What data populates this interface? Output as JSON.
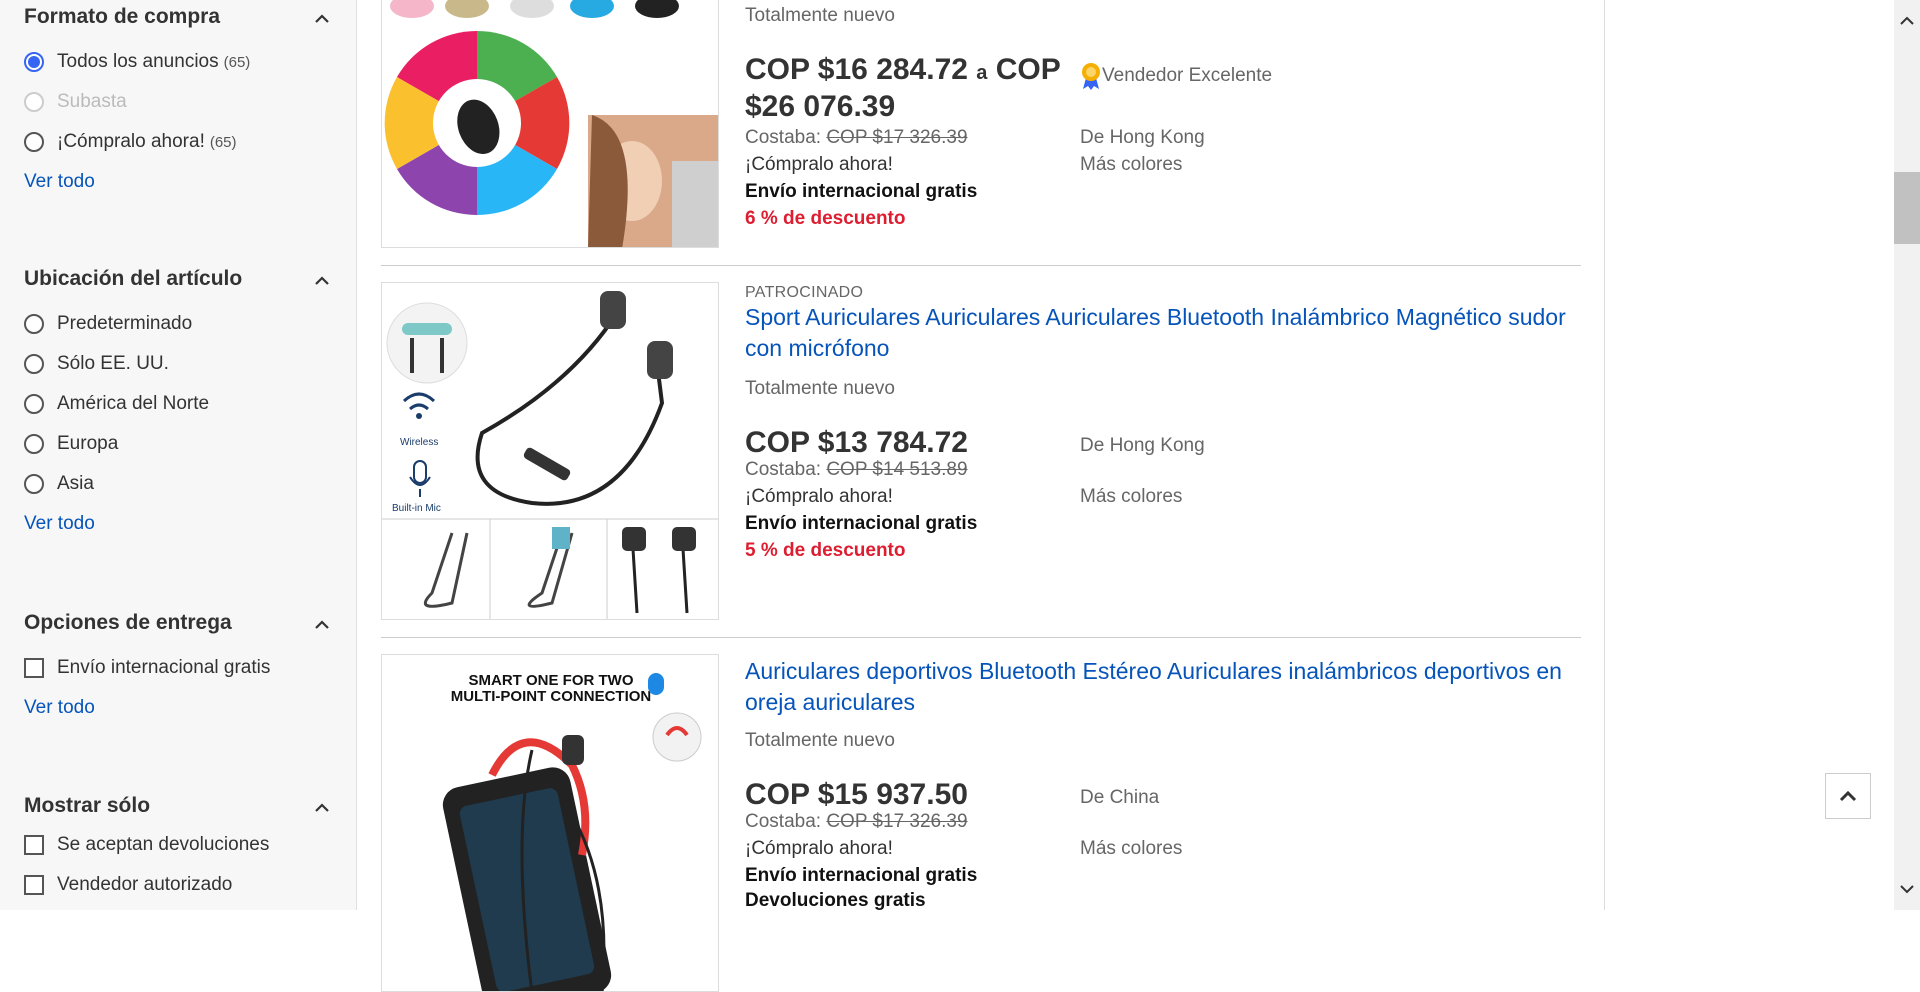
{
  "sidebar": {
    "formato": {
      "title": "Formato de compra",
      "options": [
        {
          "label": "Todos los anuncios",
          "count": "(65)"
        },
        {
          "label": "Subasta"
        },
        {
          "label": "¡Cómpralo ahora!",
          "count": "(65)"
        }
      ],
      "see_all": "Ver todo"
    },
    "ubicacion": {
      "title": "Ubicación del artículo",
      "options": [
        "Predeterminado",
        "Sólo EE. UU.",
        "América del Norte",
        "Europa",
        "Asia"
      ],
      "see_all": "Ver todo"
    },
    "entrega": {
      "title": "Opciones de entrega",
      "options": [
        "Envío internacional gratis"
      ],
      "see_all": "Ver todo"
    },
    "mostrar": {
      "title": "Mostrar sólo",
      "options": [
        "Se aceptan devoluciones",
        "Vendedor autorizado"
      ]
    }
  },
  "items": [
    {
      "condition": "Totalmente nuevo",
      "price": "COP $16 284.72",
      "price_sep": "a",
      "price_to": "COP $26 076.39",
      "was_label": "Costaba:",
      "was_price": "COP $17 326.39",
      "buy": "¡Cómpralo ahora!",
      "ship": "Envío internacional gratis",
      "discount": "6 % de descuento",
      "seller_badge": "Vendedor Excelente",
      "from": "De Hong Kong",
      "colors": "Más colores"
    },
    {
      "sponsored": "PATROCINADO",
      "title": "Sport Auriculares Auriculares Auriculares Bluetooth Inalámbrico Magnético sudor con micrófono",
      "condition": "Totalmente nuevo",
      "price": "COP $13 784.72",
      "was_label": "Costaba:",
      "was_price": "COP $14 513.89",
      "buy": "¡Cómpralo ahora!",
      "ship": "Envío internacional gratis",
      "discount": "5 % de descuento",
      "from": "De Hong Kong",
      "colors": "Más colores",
      "img_labels": {
        "wireless": "Wireless",
        "mic": "Built-in Mic"
      }
    },
    {
      "title": "Auriculares deportivos Bluetooth Estéreo Auriculares inalámbricos deportivos en oreja auriculares",
      "condition": "Totalmente nuevo",
      "price": "COP $15 937.50",
      "was_label": "Costaba:",
      "was_price": "COP $17 326.39",
      "buy": "¡Cómpralo ahora!",
      "ship": "Envío internacional gratis",
      "returns": "Devoluciones gratis",
      "from": "De China",
      "colors": "Más colores",
      "img_labels": {
        "line1": "SMART ONE FOR TWO",
        "line2": "MULTI-POINT CONNECTION"
      }
    }
  ],
  "colors": {
    "link": "#0654ba",
    "discount": "#dd1e31",
    "radio": "#3665f3"
  }
}
